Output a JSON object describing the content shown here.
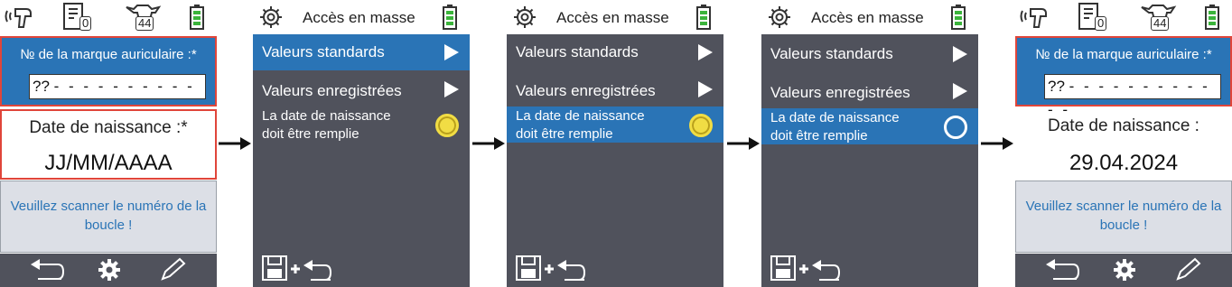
{
  "screen1": {
    "badge_count": "0",
    "cow_count": "44",
    "tag_label": "№ de la marque auriculaire :*",
    "tag_value": "??",
    "tag_placeholder": "- - - - - - - - - - - -",
    "date_label": "Date de naissance :*",
    "date_value": "JJ/MM/AAAA",
    "message": "Veuillez scanner le numéro de la boucle !"
  },
  "menu": {
    "title": "Accès en masse",
    "item1": "Valeurs standards",
    "item2": "Valeurs enregistrées",
    "item3_line1": "La date de naissance",
    "item3_line2": "doit être remplie"
  },
  "screen5": {
    "badge_count": "0",
    "cow_count": "44",
    "tag_label": "№ de la marque auriculaire :*",
    "tag_value": "??",
    "tag_placeholder": "- - - - - - - - - - - -",
    "date_label": "Date de naissance :",
    "date_value": "29.04.2024",
    "message": "Veuillez scanner le numéro de la boucle !"
  },
  "colors": {
    "accent": "#2a74b6",
    "panel": "#50525c",
    "error_border": "#e0453a",
    "radio_on": "#f1dd44",
    "battery": "#3bb43b"
  }
}
